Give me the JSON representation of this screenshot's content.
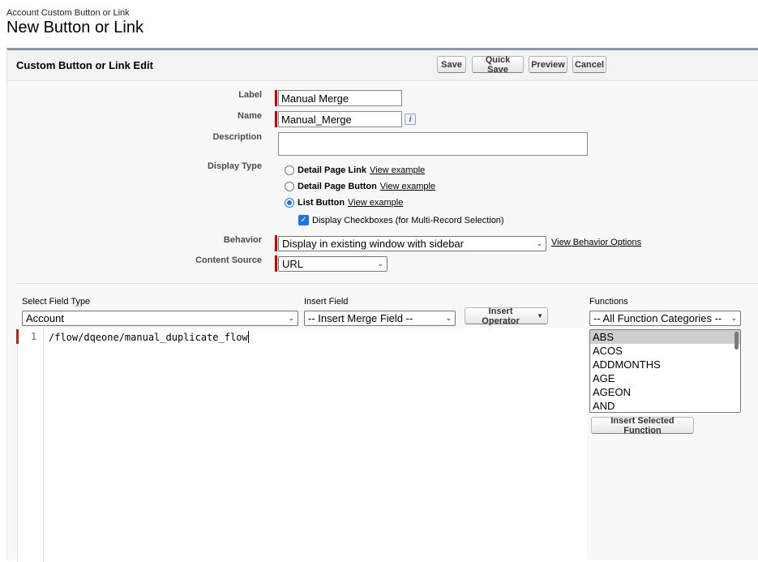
{
  "page": {
    "subtitle": "Account Custom Button or Link",
    "title": "New Button or Link"
  },
  "panel": {
    "title": "Custom Button or Link Edit",
    "buttons": {
      "save": "Save",
      "quick_save": "Quick Save",
      "preview": "Preview",
      "cancel": "Cancel"
    }
  },
  "form": {
    "label": {
      "label": "Label",
      "value": "Manual Merge"
    },
    "name": {
      "label": "Name",
      "value": "Manual_Merge",
      "info": "i"
    },
    "description": {
      "label": "Description",
      "value": ""
    },
    "display_type": {
      "label": "Display Type",
      "options": [
        {
          "label": "Detail Page Link",
          "link": "View example",
          "checked": false
        },
        {
          "label": "Detail Page Button",
          "link": "View example",
          "checked": false
        },
        {
          "label": "List Button",
          "link": "View example",
          "checked": true
        }
      ],
      "checkbox": {
        "label": "Display Checkboxes (for Multi-Record Selection)",
        "checked": true,
        "mark": "✓"
      }
    },
    "behavior": {
      "label": "Behavior",
      "value": "Display in existing window with sidebar",
      "link": "View Behavior Options"
    },
    "content_source": {
      "label": "Content Source",
      "value": "URL"
    }
  },
  "formula_editor": {
    "select_field_type": {
      "label": "Select Field Type",
      "value": "Account"
    },
    "insert_field": {
      "label": "Insert Field",
      "value": "-- Insert Merge Field --"
    },
    "insert_operator": {
      "label": "Insert Operator",
      "arrow": "▼"
    },
    "functions": {
      "label": "Functions",
      "category": "-- All Function Categories --",
      "items": [
        "ABS",
        "ACOS",
        "ADDMONTHS",
        "AGE",
        "AGEON",
        "AND"
      ],
      "selected_index": 0,
      "insert_button": "Insert Selected Function"
    },
    "code": {
      "line_number": "1",
      "text": "/flow/dqeone/manual_duplicate_flow"
    }
  },
  "icons": {
    "chevron": "⌄"
  }
}
